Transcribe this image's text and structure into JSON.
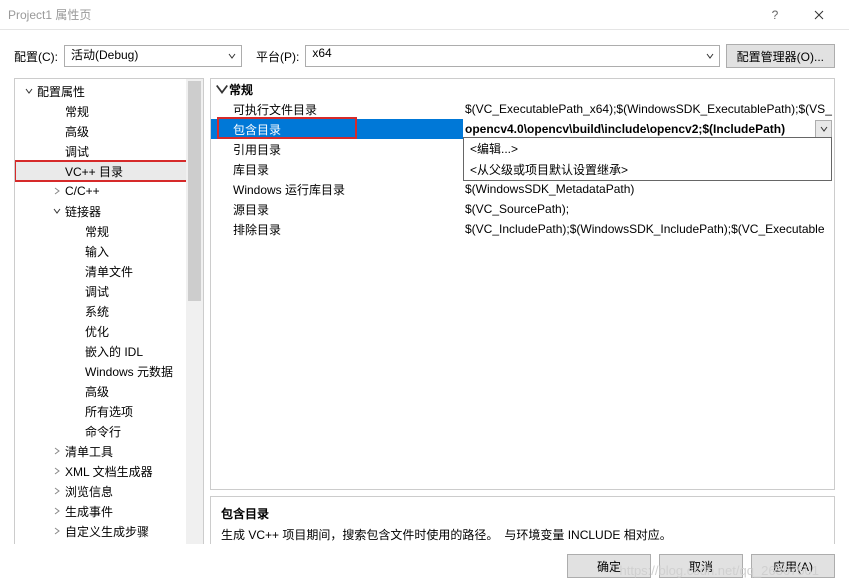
{
  "window": {
    "title": "Project1 属性页",
    "help_icon": "?",
    "close_icon": "×"
  },
  "toolbar": {
    "config_label": "配置(C):",
    "config_value": "活动(Debug)",
    "platform_label": "平台(P):",
    "platform_value": "x64",
    "manager_button": "配置管理器(O)..."
  },
  "tree": [
    {
      "label": "配置属性",
      "level": 1,
      "expander": "down"
    },
    {
      "label": "常规",
      "level": 2
    },
    {
      "label": "高级",
      "level": 2
    },
    {
      "label": "调试",
      "level": 2
    },
    {
      "label": "VC++ 目录",
      "level": 2,
      "selected": true,
      "highlight": true
    },
    {
      "label": "C/C++",
      "level": 2,
      "expander": "right"
    },
    {
      "label": "链接器",
      "level": 2,
      "expander": "down"
    },
    {
      "label": "常规",
      "level": 3
    },
    {
      "label": "输入",
      "level": 3
    },
    {
      "label": "清单文件",
      "level": 3
    },
    {
      "label": "调试",
      "level": 3
    },
    {
      "label": "系统",
      "level": 3
    },
    {
      "label": "优化",
      "level": 3
    },
    {
      "label": "嵌入的 IDL",
      "level": 3
    },
    {
      "label": "Windows 元数据",
      "level": 3
    },
    {
      "label": "高级",
      "level": 3
    },
    {
      "label": "所有选项",
      "level": 3
    },
    {
      "label": "命令行",
      "level": 3
    },
    {
      "label": "清单工具",
      "level": 2,
      "expander": "right"
    },
    {
      "label": "XML 文档生成器",
      "level": 2,
      "expander": "right"
    },
    {
      "label": "浏览信息",
      "level": 2,
      "expander": "right"
    },
    {
      "label": "生成事件",
      "level": 2,
      "expander": "right"
    },
    {
      "label": "自定义生成步骤",
      "level": 2,
      "expander": "right"
    }
  ],
  "grid": {
    "section": "常规",
    "rows": [
      {
        "name": "可执行文件目录",
        "value": "$(VC_ExecutablePath_x64);$(WindowsSDK_ExecutablePath);$(VS_"
      },
      {
        "name": "包含目录",
        "value": "opencv4.0\\opencv\\build\\include\\opencv2;$(IncludePath)",
        "selected": true,
        "highlight": true,
        "dropdown": true
      },
      {
        "name": "引用目录",
        "value": ""
      },
      {
        "name": "库目录",
        "value": "<从父级或项目默认设置继承>"
      },
      {
        "name": "Windows 运行库目录",
        "value": "$(WindowsSDK_MetadataPath)"
      },
      {
        "name": "源目录",
        "value": "$(VC_SourcePath);"
      },
      {
        "name": "排除目录",
        "value": "$(VC_IncludePath);$(WindowsSDK_IncludePath);$(VC_Executable"
      }
    ],
    "edit_option": "<编辑...>"
  },
  "description": {
    "title": "包含目录",
    "text": "生成 VC++ 项目期间，搜索包含文件时使用的路径。　与环境变量 INCLUDE 相对应。"
  },
  "footer": {
    "ok": "确定",
    "cancel": "取消",
    "apply": "应用(A)"
  },
  "watermark": "https://blog.csdn.net/qq_26367501"
}
